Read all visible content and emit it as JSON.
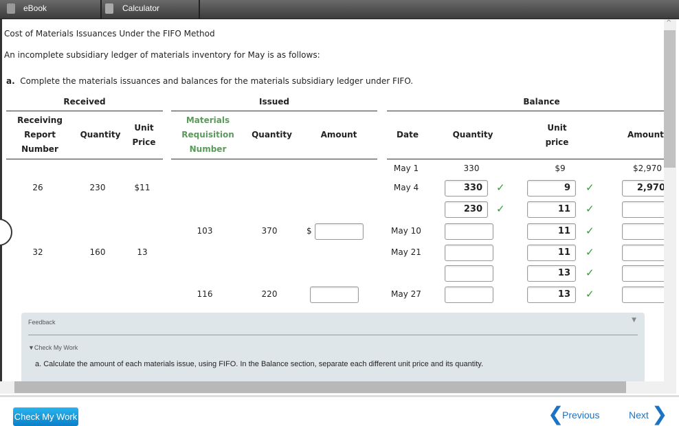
{
  "toolbar": {
    "ebook": "eBook",
    "calculator": "Calculator"
  },
  "title": "Cost of Materials Issuances Under the FIFO Method",
  "intro": "An incomplete subsidiary ledger of materials inventory for May is as follows:",
  "part_a": {
    "letter": "a.",
    "text": "Complete the materials issuances and balances for the materials subsidiary ledger under FIFO."
  },
  "groups": {
    "received": "Received",
    "issued": "Issued",
    "balance": "Balance"
  },
  "headers": {
    "rr": "Receiving Report Number",
    "rqty": "Quantity",
    "rprice": "Unit Price",
    "mr": "Materials Requisition Number",
    "iqty": "Quantity",
    "iamt": "Amount",
    "date": "Date",
    "bqty": "Quantity",
    "bprice": "Unit price",
    "bamt": "Amount"
  },
  "rows": [
    {
      "rr": "",
      "rqty": "",
      "rprice": "",
      "mr": "",
      "iqty": "",
      "iamt": null,
      "date": "May 1",
      "bqty": {
        "text": "330"
      },
      "bprice": {
        "text": "$9"
      },
      "bamt": {
        "text": "$2,970"
      }
    },
    {
      "rr": "26",
      "rqty": "230",
      "rprice": "$11",
      "mr": "",
      "iqty": "",
      "iamt": null,
      "date": "May 4",
      "bqty": {
        "input": "330",
        "check": true
      },
      "bprice": {
        "input": "9",
        "check": true
      },
      "bamt": {
        "input": "2,970"
      }
    },
    {
      "rr": "",
      "rqty": "",
      "rprice": "",
      "mr": "",
      "iqty": "",
      "iamt": null,
      "date": "",
      "bqty": {
        "input": "230",
        "check": true
      },
      "bprice": {
        "input": "11",
        "check": true
      },
      "bamt": {
        "input": ""
      }
    },
    {
      "rr": "",
      "rqty": "",
      "rprice": "",
      "mr": "103",
      "iqty": "370",
      "iamt": {
        "input": "",
        "dollar": "$"
      },
      "date": "May 10",
      "bqty": {
        "input": ""
      },
      "bprice": {
        "input": "11",
        "check": true
      },
      "bamt": {
        "input": ""
      }
    },
    {
      "rr": "32",
      "rqty": "160",
      "rprice": "13",
      "mr": "",
      "iqty": "",
      "iamt": null,
      "date": "May 21",
      "bqty": {
        "input": ""
      },
      "bprice": {
        "input": "11",
        "check": true
      },
      "bamt": {
        "input": ""
      }
    },
    {
      "rr": "",
      "rqty": "",
      "rprice": "",
      "mr": "",
      "iqty": "",
      "iamt": null,
      "date": "",
      "bqty": {
        "input": ""
      },
      "bprice": {
        "input": "13",
        "check": true
      },
      "bamt": {
        "input": ""
      }
    },
    {
      "rr": "",
      "rqty": "",
      "rprice": "",
      "mr": "116",
      "iqty": "220",
      "iamt": {
        "input": ""
      },
      "date": "May 27",
      "bqty": {
        "input": ""
      },
      "bprice": {
        "input": "13",
        "check": true
      },
      "bamt": {
        "input": ""
      }
    }
  ],
  "feedback": {
    "label": "Feedback",
    "toggle": "Check My Work",
    "text": "a. Calculate the amount of each materials issue, using FIFO. In the Balance section, separate each different unit price and its quantity."
  },
  "footer": {
    "check": "Check My Work",
    "previous": "Previous",
    "next": "Next"
  },
  "colors": {
    "accent": "#1a73c4",
    "check": "#2e9e2e",
    "header_green": "#5a9a5a"
  }
}
